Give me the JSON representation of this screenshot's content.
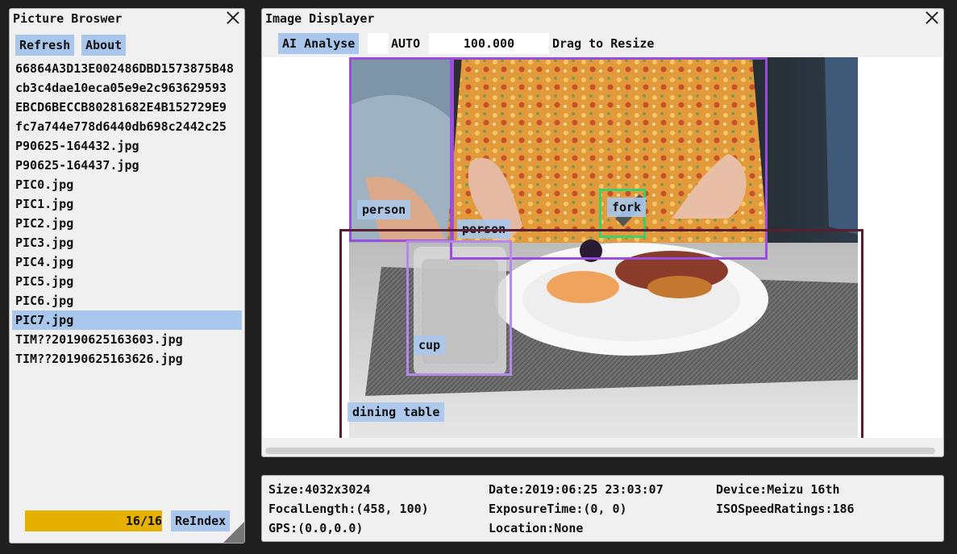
{
  "browser": {
    "title": "Picture Broswer",
    "refresh_label": "Refresh",
    "about_label": "About",
    "files": [
      "66864A3D13E002486DBD1573875B48",
      "cb3c4dae10eca05e9e2c963629593",
      "EBCD6BECCB80281682E4B152729E9",
      "fc7a744e778d6440db698c2442c25",
      "P90625-164432.jpg",
      "P90625-164437.jpg",
      "PIC0.jpg",
      "PIC1.jpg",
      "PIC2.jpg",
      "PIC3.jpg",
      "PIC4.jpg",
      "PIC5.jpg",
      "PIC6.jpg",
      "PIC7.jpg",
      "TIM??20190625163603.jpg",
      "TIM??20190625163626.jpg"
    ],
    "selected_index": 13,
    "progress_text": "16/16",
    "progress_fraction": 1.0,
    "reindex_label": "ReIndex",
    "accent_color": "#a9c6ec",
    "progress_color": "#e6b000"
  },
  "displayer": {
    "title": "Image Displayer",
    "ai_label": "AI Analyse",
    "auto_label": "AUTO",
    "zoom_value": "100.000",
    "drag_label": "Drag to Resize",
    "detections": [
      {
        "label": "person",
        "color": "#9b4de0"
      },
      {
        "label": "person",
        "color": "#9b4de0"
      },
      {
        "label": "fork",
        "color": "#3ccf6a"
      },
      {
        "label": "cup",
        "color": "#b38ae8"
      },
      {
        "label": "dining table",
        "color": "#5a1e2e"
      }
    ]
  },
  "info": {
    "size": "Size:4032x3024",
    "date": "Date:2019:06:25 23:03:07",
    "device": "Device:Meizu 16th",
    "focal": "FocalLength:(458, 100)",
    "exposure": "ExposureTime:(0, 0)",
    "iso": "ISOSpeedRatings:186",
    "gps": "GPS:(0.0,0.0)",
    "location": "Location:None"
  }
}
